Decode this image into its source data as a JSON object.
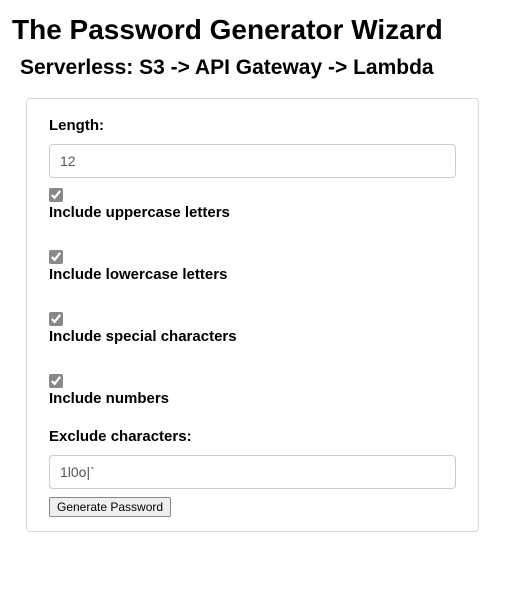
{
  "heading": "The Password Generator Wizard",
  "subheading": "Serverless: S3 -> API Gateway -> Lambda",
  "form": {
    "length_label": "Length:",
    "length_value": "12",
    "uppercase": {
      "label": "Include uppercase letters",
      "checked": true
    },
    "lowercase": {
      "label": "Include lowercase letters",
      "checked": true
    },
    "special": {
      "label": "Include special characters",
      "checked": true
    },
    "numbers": {
      "label": "Include numbers",
      "checked": true
    },
    "exclude_label": "Exclude characters:",
    "exclude_value": "1l0o|`",
    "generate_label": "Generate Password"
  }
}
